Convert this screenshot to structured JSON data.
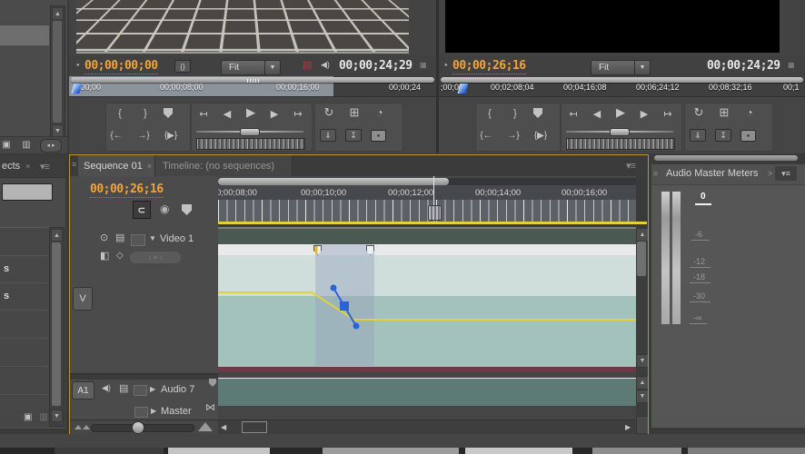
{
  "app": {
    "name": "premiere-editing-workspace"
  },
  "colors": {
    "accent_orange": "#F2A33A",
    "focus_border": "#BB9631",
    "rubber_band_yellow": "#DFD23F",
    "keyframe_blue": "#2B62D9",
    "clip_upper": "#CFDEDA",
    "clip_lower": "#A2C2BB",
    "audio_clip": "#5D7A74",
    "selection_overlay": "#97A8C0"
  },
  "icons": {
    "grip": "≡",
    "panel_menu": "▾≡",
    "close": "×",
    "dropdown_arrow": "▼",
    "dot": "●",
    "timecode_toggle": "{}",
    "film": "▤",
    "speaker": "◀)",
    "set_in": "{",
    "set_out": "}",
    "goto_in": "↤",
    "step_back": "◀",
    "play": "▶",
    "step_fwd": "▶",
    "goto_out": "↦",
    "play_from_in": "{←",
    "goto_out_brace": "→}",
    "play_in_out": "{▶}",
    "loop": "↻",
    "safe_margins": "⊞",
    "output_settings": "◔",
    "insert": "⇓",
    "overwrite": "↧",
    "camera": "●",
    "settings_grid": "▦",
    "eye": "⊙",
    "track_output": "▤",
    "display_style": "◧",
    "show_keyframes": "◇",
    "keyframe_nav": "‹ ⋄ ›",
    "snap": "∪",
    "encore_marker": "◉",
    "collapsed": "▶",
    "expanded": "▼",
    "bowtie": "⋈",
    "scroll_up": "▲",
    "scroll_down": "▼",
    "scroll_left": "◀",
    "scroll_right": "▶",
    "chevron": ">",
    "new_bin": "▣",
    "trash": "▥",
    "nav_pair": "◂ ▸"
  },
  "source_monitor": {
    "timecode_current": "00;00;00;00",
    "zoom_select": "Fit",
    "timecode_total": "00;00;24;29",
    "ruler_labels": [
      ";00;00",
      "00;00;08;00",
      "00;00;16;00",
      "00;00;24"
    ]
  },
  "program_monitor": {
    "timecode_current": "00;00;26;16",
    "zoom_select": "Fit",
    "timecode_total": "00;00;24;29",
    "ruler_labels": [
      ";00;00",
      "00;02;08;04",
      "00;04;16;08",
      "00;06;24;12",
      "00;08;32;16",
      "00;1"
    ]
  },
  "timeline": {
    "tabs": [
      "Sequence 01",
      "Timeline: (no sequences)"
    ],
    "timecode": "00;00;26;16",
    "ruler_labels": [
      "0;00;08;00",
      "00;00;10;00",
      "00;00;12;00",
      "00;00;14;00",
      "00;00;16;00"
    ],
    "video_track": {
      "target_badge": "V",
      "label": "Video 1"
    },
    "audio_track": {
      "target_badge": "A1",
      "label": "Audio 7"
    },
    "master_track": {
      "label": "Master"
    }
  },
  "audio_meters": {
    "title": "Audio Master Meters",
    "scale_labels": [
      "0",
      "-6",
      "-12",
      "-18",
      "-30",
      "-∞"
    ]
  },
  "effects_panel": {
    "tab_label_fragment": "ects",
    "list_fragments": [
      "s",
      "s"
    ]
  }
}
